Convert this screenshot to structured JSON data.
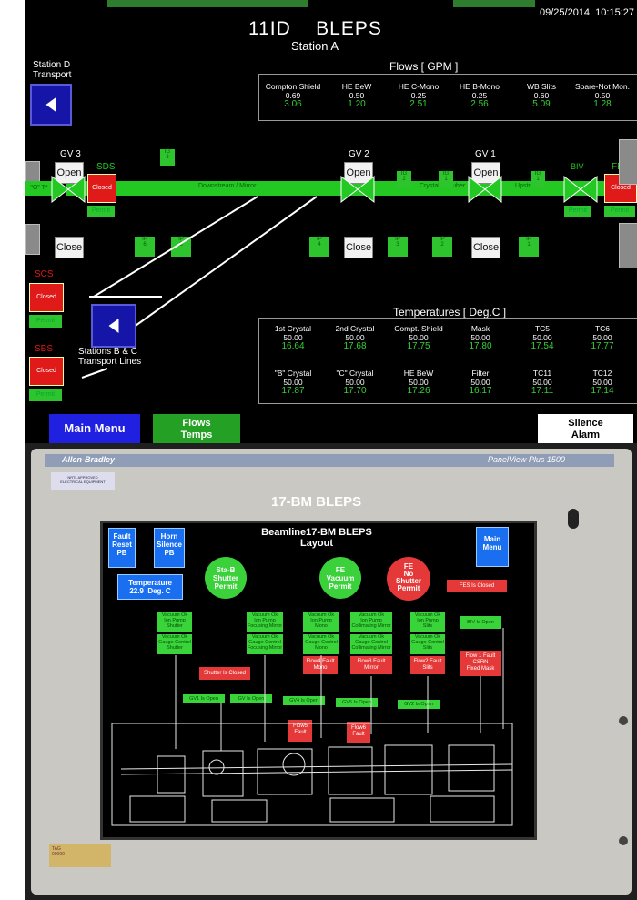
{
  "top_panel": {
    "title": "11ID    BLEPS",
    "subtitle": "Station A",
    "datetime": "09/25/2014  10:15:27",
    "station_d_label": "Station D\nTransport",
    "flows": {
      "header": "Flows [ GPM ]",
      "columns": [
        {
          "name": "Compton Shield",
          "set": "0.69",
          "value": "3.06"
        },
        {
          "name": "HE BeW",
          "set": "0.50",
          "value": "1.20"
        },
        {
          "name": "HE C-Mono",
          "set": "0.25",
          "value": "2.51"
        },
        {
          "name": "HE B-Mono",
          "set": "0.25",
          "value": "2.56"
        },
        {
          "name": "WB Slits",
          "set": "0.60",
          "value": "5.09"
        },
        {
          "name": "Spare-Not Mon.",
          "set": "0.50",
          "value": "1.28"
        }
      ]
    },
    "valves": {
      "gv3": "GV 3",
      "gv2": "GV 2",
      "gv1": "GV 1",
      "open": "Open",
      "close": "Close",
      "sds": "SDS",
      "biv": "BIV",
      "fes": "FES",
      "ot": "\"O\" T*",
      "closed": "Closed",
      "permit": "Permit"
    },
    "pipe_labels": {
      "downstream": "Downstream / Mirror",
      "crystals": "Crystals / Huber",
      "upstream": "Upstream"
    },
    "ip_tags": [
      "IP\n6",
      "IP\n5",
      "IP\n4",
      "IP\n3",
      "IP\n2",
      "IP\n1"
    ],
    "ig_tags": [
      "IG\n3",
      "IG\n2",
      "IG\n1",
      "IG\n1"
    ],
    "scs": "SCS",
    "sbs": "SBS",
    "stations_bc": "Stations B & C\nTransport Lines",
    "temperatures": {
      "header": "Temperatures [ Deg.C ]",
      "row1": [
        {
          "name": "1st Crystal",
          "set": "50.00",
          "value": "16.64"
        },
        {
          "name": "2nd Crystal",
          "set": "50.00",
          "value": "17.68"
        },
        {
          "name": "Compt. Shield",
          "set": "50.00",
          "value": "17.75"
        },
        {
          "name": "Mask",
          "set": "50.00",
          "value": "17.80"
        },
        {
          "name": "TC5",
          "set": "50.00",
          "value": "17.54"
        },
        {
          "name": "TC6",
          "set": "50.00",
          "value": "17.77"
        }
      ],
      "row2": [
        {
          "name": "\"B\" Crystal",
          "set": "50.00",
          "value": "17.87"
        },
        {
          "name": "\"C\" Crystal",
          "set": "50.00",
          "value": "17.70"
        },
        {
          "name": "HE BeW",
          "set": "50.00",
          "value": "17.26"
        },
        {
          "name": "Filter",
          "set": "50.00",
          "value": "16.17"
        },
        {
          "name": "TC11",
          "set": "50.00",
          "value": "17.11"
        },
        {
          "name": "TC12",
          "set": "50.00",
          "value": "17.14"
        }
      ]
    },
    "buttons": {
      "main_menu": "Main Menu",
      "flows_temps": "Flows\nTemps",
      "silence_alarm": "Silence\nAlarm"
    }
  },
  "bottom_photo": {
    "brand": "Allen-Bradley",
    "model": "PanelView Plus 1500",
    "sticker": "NRTL APPROVED\nELECTRICAL EQUIPMENT",
    "caption": "17-BM BLEPS",
    "screen_title": "Beamline17-BM BLEPS\nLayout",
    "fault_reset": "Fault\nReset\nPB",
    "horn_silence": "Horn\nSilence\nPB",
    "main_menu": "Main\nMenu",
    "temperature": "Temperature\n22.9  Deg. C",
    "sta_b_permit": "Sta-B\nShutter\nPermit",
    "fe_vacuum_permit": "FE\nVacuum\nPermit",
    "fe_no_shutter_permit": "FE\nNo\nShutter\nPermit",
    "fes_closed": "FES Is Closed",
    "shutter_closed": "Shutter Is Closed",
    "faults": [
      "Flow4 Fault\nMono",
      "Flow3 Fault\nMirror",
      "Flow2 Fault\nSlits",
      "Flow 1 Fault\nCSRN\nFixed Mask",
      "Flow5\nFault",
      "Flow6\nFault"
    ],
    "biv_open": "BIV Is Open",
    "gv_open": [
      "GV1 Is Open",
      "GV Is Open",
      "GV4 Is Open",
      "GV5 Is Open",
      "GV2 Is Open"
    ],
    "vacuum_boxes": [
      "Vacuum Ok\nIon Pump\nShutter",
      "Vacuum Ok\nIon Pump\nFocusing Mirror",
      "Vacuum Ok\nIon Pump\nMono",
      "Vacuum Ok\nIon Pump\nCollimating Mirror",
      "Vacuum Ok\nIon Pump\nSlits",
      "Vacuum Ok\nGauge Control\nShutter",
      "Vacuum Ok\nGauge Control\nFocusing Mirror",
      "Vacuum Ok\nGauge Control\nMono",
      "Vacuum Ok\nGauge Control\nCollimating Mirror",
      "Vacuum Ok\nGauge Control\nSlits"
    ],
    "label_sticker": "TAG\n00000"
  },
  "colors": {
    "panel_bg": "#000000",
    "pipe_green": "#23c823",
    "alarm_red": "#e01919",
    "nav_blue": "#1515a8",
    "value_green": "#34d134"
  }
}
